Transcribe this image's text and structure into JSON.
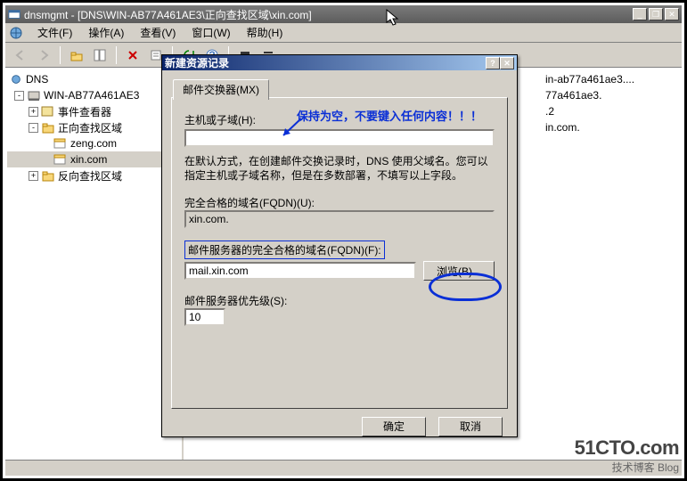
{
  "app": {
    "titlebar": "dnsmgmt - [DNS\\WIN-AB77A461AE3\\正向查找区域\\xin.com]"
  },
  "menu": {
    "file": "文件(F)",
    "action": "操作(A)",
    "view": "查看(V)",
    "window": "窗口(W)",
    "help": "帮助(H)"
  },
  "tree": {
    "root": "DNS",
    "server": "WIN-AB77A461AE3",
    "eventviewer": "事件查看器",
    "fwzone": "正向查找区域",
    "zone1": "zeng.com",
    "zone2": "xin.com",
    "revzone": "反向查找区域"
  },
  "main": {
    "r1": "in-ab77a461ae3....",
    "r2": "77a461ae3.",
    "r3": ".2",
    "r4": "in.com."
  },
  "dialog": {
    "title": "新建资源记录",
    "tab": "邮件交换器(MX)",
    "host_label": "主机或子域(H):",
    "host_value": "",
    "desc": "在默认方式，在创建邮件交换记录时，DNS 使用父域名。您可以指定主机或子域名称，但是在多数部署，不填写以上字段。",
    "fqdn_label": "完全合格的域名(FQDN)(U):",
    "fqdn_value": "xin.com.",
    "mailfqdn_label": "邮件服务器的完全合格的域名(FQDN)(F):",
    "mailfqdn_value": "mail.xin.com",
    "browse": "浏览(B)...",
    "priority_label": "邮件服务器优先级(S):",
    "priority_value": "10",
    "ok": "确定",
    "cancel": "取消"
  },
  "annotation": {
    "text": "保持为空，不要键入任何内容！！！"
  },
  "watermark": {
    "big": "51CTO.com",
    "sub": "技术博客   Blog"
  }
}
